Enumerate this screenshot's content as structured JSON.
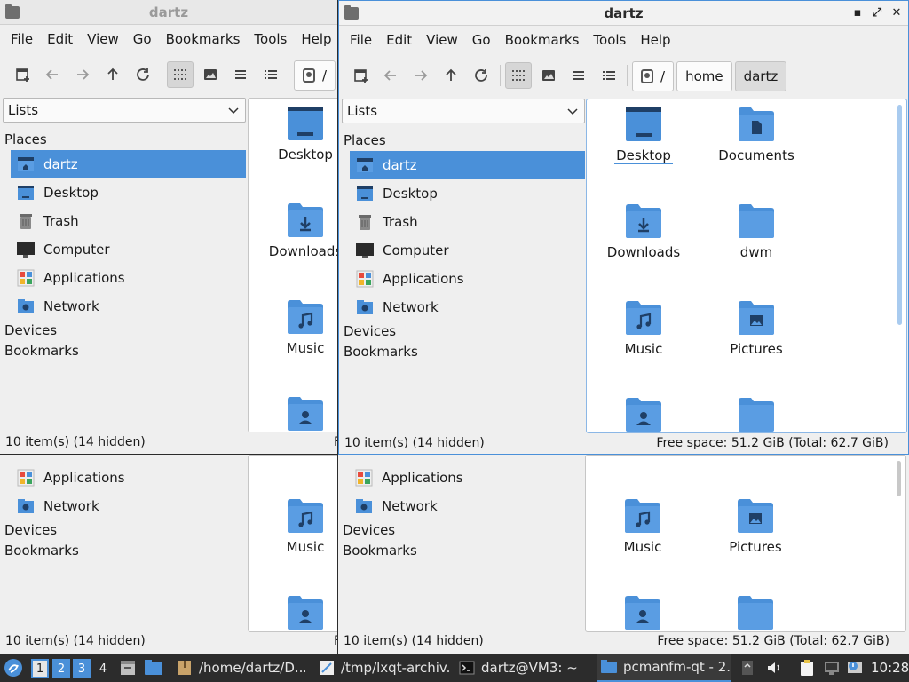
{
  "window_title": "dartz",
  "menu": [
    "File",
    "Edit",
    "View",
    "Go",
    "Bookmarks",
    "Tools",
    "Help"
  ],
  "breadcrumbs": {
    "root": "/",
    "parts": [
      "home",
      "dartz"
    ]
  },
  "sidebar": {
    "dropdown": "Lists",
    "places_label": "Places",
    "items": [
      {
        "label": "dartz",
        "icon": "home-icon",
        "selected": true
      },
      {
        "label": "Desktop",
        "icon": "desktop-icon"
      },
      {
        "label": "Trash",
        "icon": "trash-icon"
      },
      {
        "label": "Computer",
        "icon": "computer-icon"
      },
      {
        "label": "Applications",
        "icon": "applications-icon"
      },
      {
        "label": "Network",
        "icon": "network-icon"
      }
    ],
    "devices_label": "Devices",
    "bookmarks_label": "Bookmarks"
  },
  "files": [
    {
      "name": "Desktop",
      "icon": "folder-desktop-icon"
    },
    {
      "name": "Documents",
      "icon": "folder-documents-icon"
    },
    {
      "name": "Downloads",
      "icon": "folder-downloads-icon"
    },
    {
      "name": "dwm",
      "icon": "folder-icon"
    },
    {
      "name": "Music",
      "icon": "folder-music-icon"
    },
    {
      "name": "Pictures",
      "icon": "folder-pictures-icon"
    },
    {
      "name": "",
      "icon": "folder-user-icon"
    },
    {
      "name": "",
      "icon": "folder-icon"
    }
  ],
  "status": {
    "items": "10 item(s) (14 hidden)",
    "free_space": "Free space: 51.2 GiB (Total: 62.7 GiB)",
    "truncated_free": "F"
  },
  "taskbar": {
    "desktops": [
      "1",
      "2",
      "3",
      "4"
    ],
    "tasks": [
      {
        "label": "/home/dartz/D...",
        "icon": "archive-icon"
      },
      {
        "label": "/tmp/lxqt-archiv...",
        "icon": "editor-icon"
      },
      {
        "label": "dartz@VM3: ~",
        "icon": "terminal-icon"
      },
      {
        "label": "pcmanfm-qt - 2...",
        "icon": "folder-icon",
        "active": true
      }
    ],
    "clock": "10:28"
  },
  "colors": {
    "accent": "#4a90d9",
    "folder": "#4a90d9",
    "folder_dark": "#2d5d8f",
    "taskbar": "#2c2c2c"
  }
}
